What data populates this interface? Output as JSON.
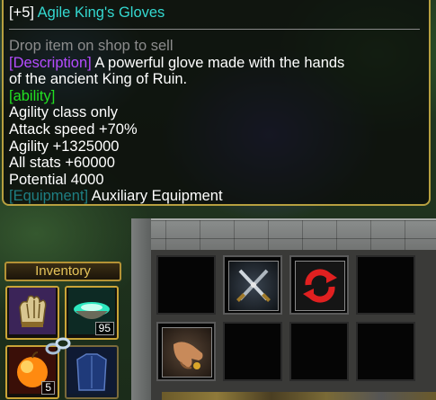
{
  "tooltip": {
    "level": "[+5]",
    "item_name": "Agile King's Gloves",
    "hint": "Drop item on shop to sell",
    "description_tag": "[Description]",
    "description_line1": " A powerful glove made with the hands",
    "description_line2": "of the ancient King of Ruin.",
    "ability_tag": "[ability]",
    "stats": [
      "Agility class only",
      "Attack speed +70%",
      "Agility +1325000",
      "All stats +60000",
      "Potential 4000"
    ],
    "equipment_tag": "[Equipment]",
    "equipment_type": " Auxiliary Equipment"
  },
  "inventory": {
    "header": "Inventory",
    "slots": [
      {
        "icon": "glove-icon",
        "count": null
      },
      {
        "icon": "mana-bowl-icon",
        "count": "95"
      },
      {
        "icon": "golden-apple-icon",
        "count": "5"
      },
      {
        "icon": "blue-armor-icon",
        "count": null
      }
    ]
  },
  "stash": {
    "slots": [
      {
        "icon": null
      },
      {
        "icon": "crossed-swords-icon"
      },
      {
        "icon": "red-cycle-icon"
      },
      {
        "icon": null
      },
      {
        "icon": "hand-icon"
      },
      {
        "icon": null
      },
      {
        "icon": null
      },
      {
        "icon": null
      }
    ]
  },
  "colors": {
    "item_name": "#34d8d0",
    "hint": "#8c8c8c",
    "description_tag": "#b54cff",
    "ability_tag": "#22e022",
    "equipment_tag": "#1e7e82",
    "tooltip_border": "#b7a040"
  }
}
